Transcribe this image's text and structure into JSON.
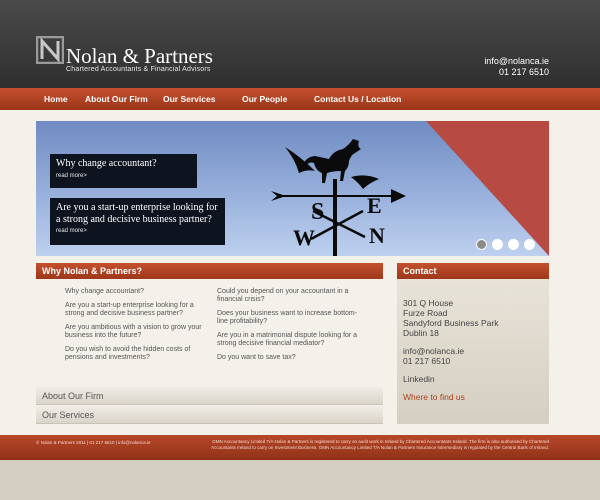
{
  "brand": {
    "name": "Nolan & Partners",
    "tagline": "Chartered Accountants & Financial Advisors",
    "email": "info@nolanca.ie",
    "phone": "01 217 6510"
  },
  "nav": {
    "items": [
      "Home",
      "About Our Firm",
      "Our Services",
      "Our People",
      "Contact Us / Location"
    ]
  },
  "hero": {
    "promo1": {
      "title": "Why change accountant?",
      "more": "read more>"
    },
    "promo2": {
      "title": "Are you a start-up enterprise looking for a strong and decisive business partner?",
      "more": "read more>"
    },
    "slides": 4,
    "active_slide": 1,
    "vane_letters": [
      "S",
      "W",
      "E",
      "N"
    ]
  },
  "why": {
    "heading": "Why Nolan & Partners?",
    "left": [
      "Why change accountant?",
      "Are you a start-up enterprise looking for a strong and decisive business partner?",
      "Are you ambitious with a vision to grow your business into the future?",
      "Do you wish to avoid the hidden costs of pensions and investments?"
    ],
    "right": [
      "Could you depend on your accountant in a financial crisis?",
      "Does your business want to increase bottom-line profitability?",
      "Are you in a matrimonial dispute looking for a strong decisive financial mediator?",
      "Do you want to save tax?"
    ]
  },
  "contact": {
    "heading": "Contact",
    "address": [
      "301 Q House",
      "Furze Road",
      "Sandyford Business Park",
      "Dublin 18"
    ],
    "email": "info@nolanca.ie",
    "phone": "01 217 6510",
    "linkedin": "Linkedin",
    "find": "Where to find us"
  },
  "accordion": [
    "About Our Firm",
    "Our Services"
  ],
  "footer": {
    "left": "© Nolan & Partners 2011 | 01 217 6510 | info@nolanca.ie",
    "right": "GMN Accountancy Limited T/A Nolan & Partners is registered to carry on audit work in Ireland by Chartered Accountants Ireland. The firm is also authorised by Chartered Accountants Ireland to carry on Investment Business. GMN Accountancy Limited T/A Nolan & Partners Insurance Intermediary is regulated by the Central Bank of Ireland."
  },
  "colors": {
    "accent": "#b0401c",
    "header": "#3a3a3a",
    "sky": "#8fa8d8"
  }
}
